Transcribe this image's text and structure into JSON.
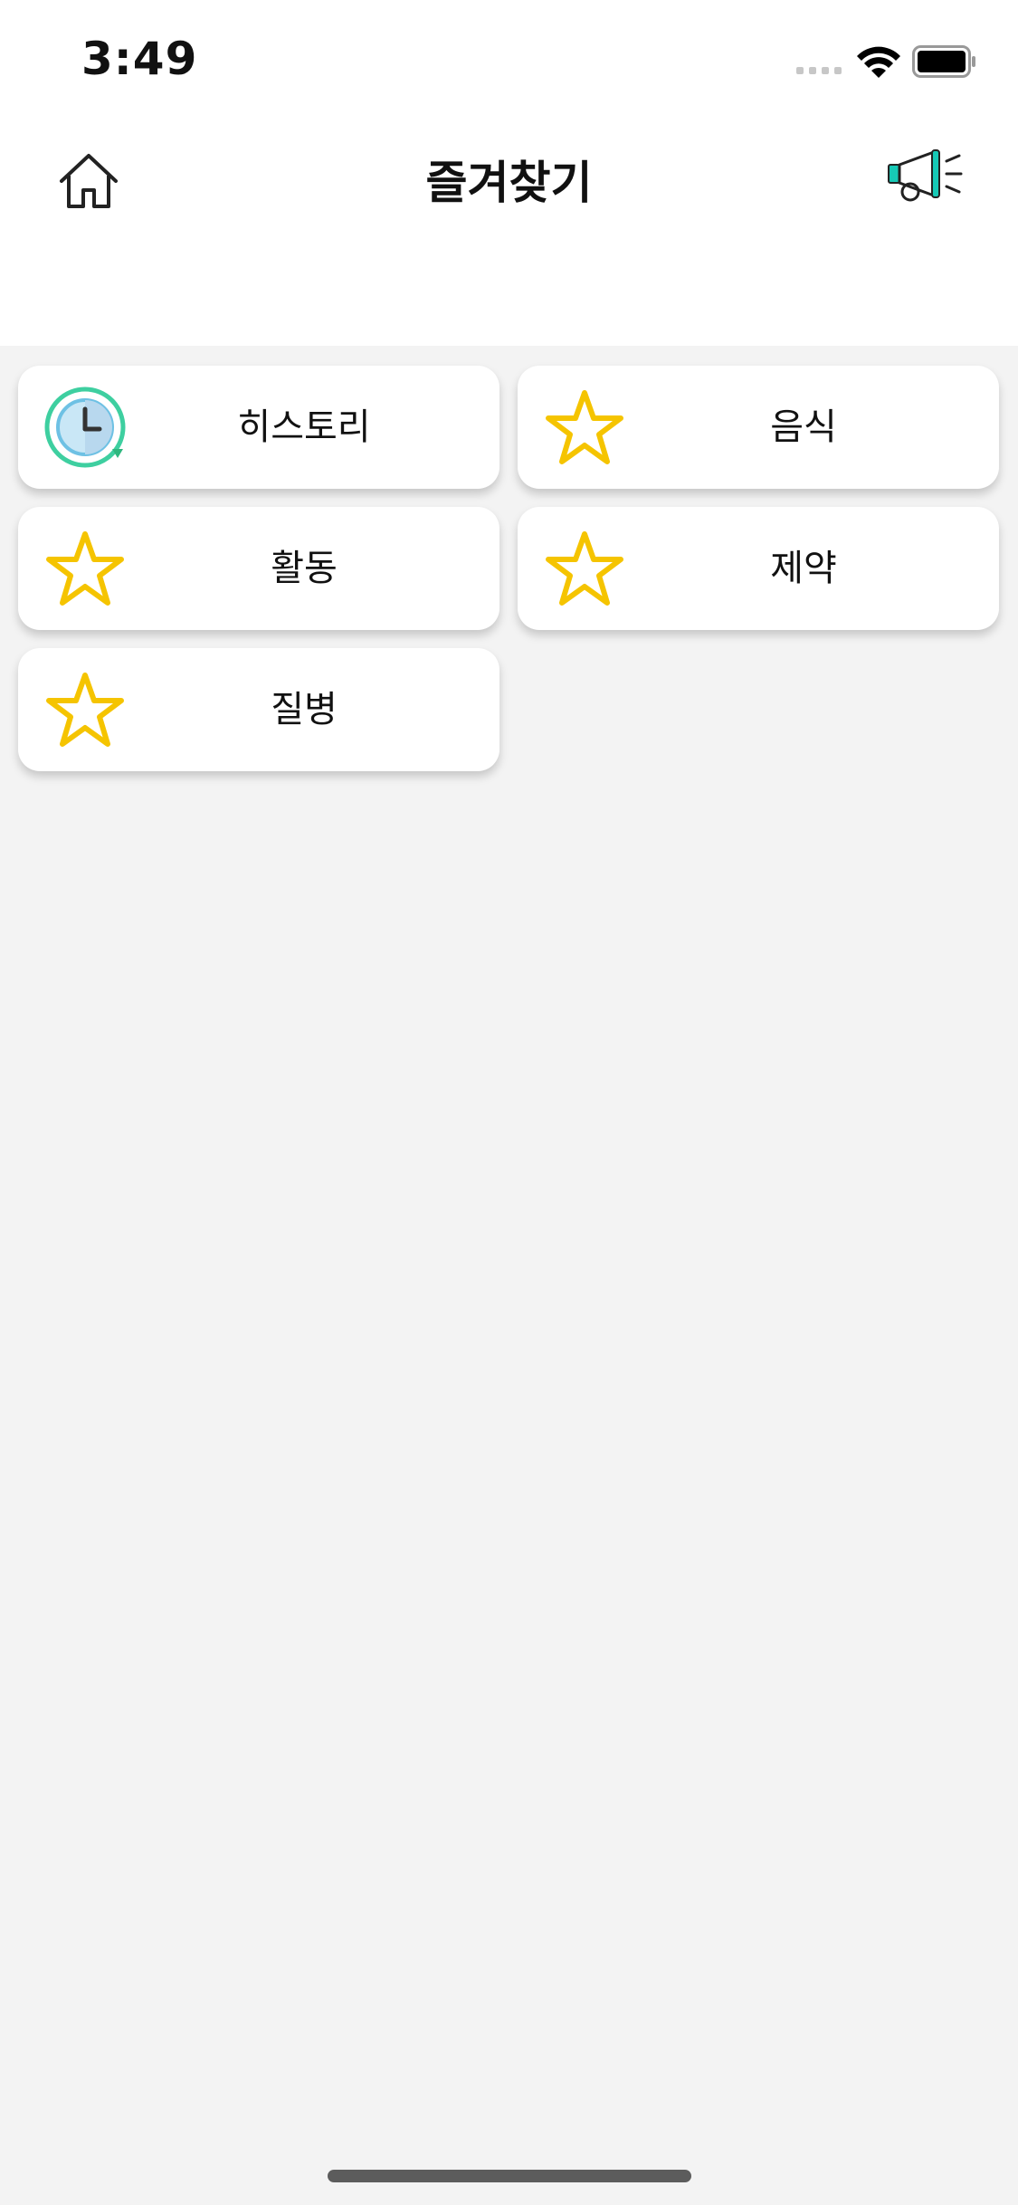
{
  "status_bar": {
    "time": "3:49"
  },
  "header": {
    "title": "즐겨찾기"
  },
  "favorites": [
    {
      "label": "히스토리",
      "icon": "history-clock-icon"
    },
    {
      "label": "음식",
      "icon": "star-icon"
    },
    {
      "label": "활동",
      "icon": "star-icon"
    },
    {
      "label": "제약",
      "icon": "star-icon"
    },
    {
      "label": "질병",
      "icon": "star-icon"
    }
  ],
  "colors": {
    "star": "#f5c400",
    "history_ring": "#3ecfa0",
    "accent": "#17c9b6"
  }
}
